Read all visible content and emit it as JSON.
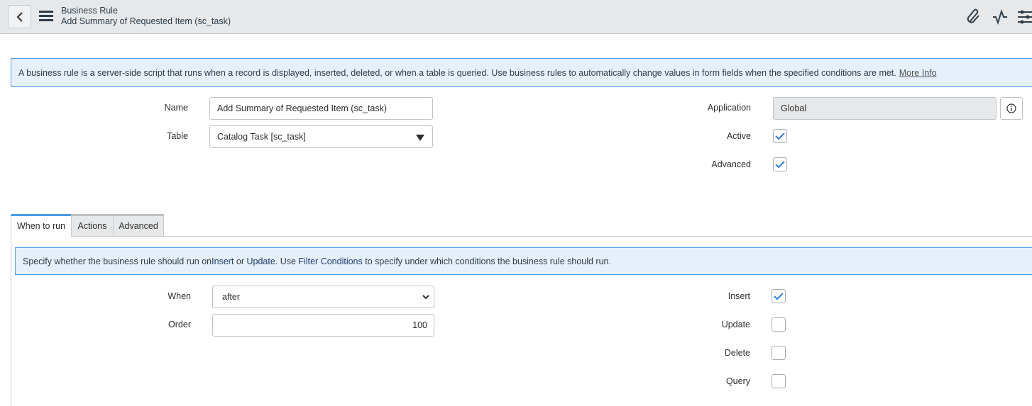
{
  "header": {
    "title": "Business Rule",
    "subtitle": "Add Summary of Requested Item (sc_task)",
    "icons": [
      "back-icon",
      "menu-icon",
      "paperclip-icon",
      "activity-icon",
      "settings-sliders-icon"
    ]
  },
  "intro": {
    "text": "A business rule is a server-side script that runs when a record is displayed, inserted, deleted, or when a table is queried. Use business rules to automatically change values in form fields when the specified conditions are met.",
    "link": "More Info"
  },
  "form": {
    "name": {
      "label": "Name",
      "value": "Add Summary of Requested Item (sc_task)"
    },
    "table": {
      "label": "Table",
      "value": "Catalog Task [sc_task]"
    },
    "application": {
      "label": "Application",
      "value": "Global"
    },
    "active": {
      "label": "Active",
      "checked": true
    },
    "advanced": {
      "label": "Advanced",
      "checked": true
    }
  },
  "tabs": [
    {
      "label": "When to run",
      "active": true
    },
    {
      "label": "Actions"
    },
    {
      "label": "Advanced"
    }
  ],
  "when_to_run": {
    "info": {
      "p1": "Specify whether the business rule should run on ",
      "insert": "Insert",
      "or": " or ",
      "update": "Update",
      "p2": ". Use ",
      "filter": "Filter Conditions",
      "p3": " to specify under which conditions the business rule should run."
    },
    "when": {
      "label": "When",
      "value": "after"
    },
    "order": {
      "label": "Order",
      "value": "100"
    },
    "insert": {
      "label": "Insert",
      "checked": true
    },
    "update": {
      "label": "Update",
      "checked": false
    },
    "delete": {
      "label": "Delete",
      "checked": false
    },
    "query": {
      "label": "Query",
      "checked": false
    }
  },
  "colors": {
    "accent": "#4a9ee8",
    "check": "#2d7fe0",
    "header_bg": "#e6e8ea",
    "info_bg": "#e6f0fa"
  }
}
